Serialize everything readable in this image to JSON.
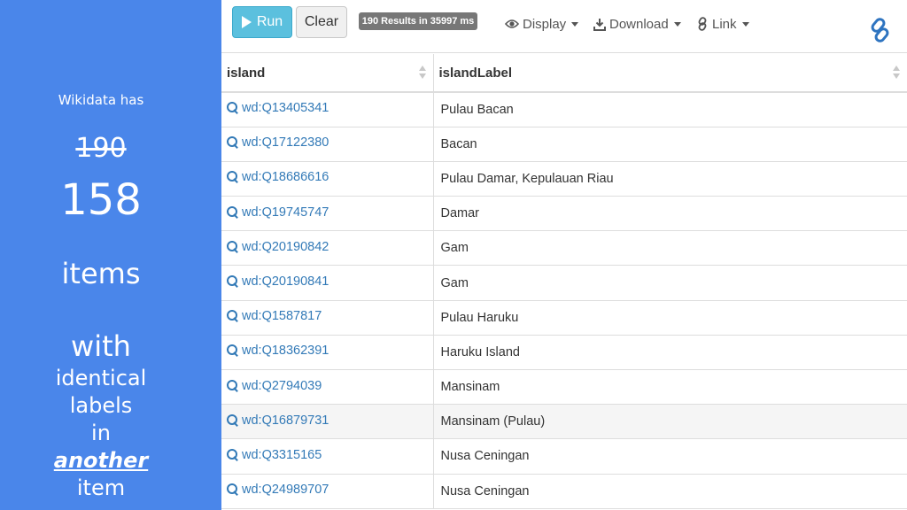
{
  "sidebar": {
    "intro": "Wikidata has",
    "old_count": "190",
    "new_count": "158",
    "items_word": "items",
    "with_word": "with",
    "identical_word": "identical",
    "labels_word": "labels",
    "in_word": "in",
    "another_word": "another",
    "item_word": "item"
  },
  "toolbar": {
    "run_label": "Run",
    "clear_label": "Clear",
    "results_text": "190 Results in 35997 ms",
    "display_label": "Display",
    "download_label": "Download",
    "link_label": "Link",
    "run_color": "#5bc0de"
  },
  "table": {
    "columns": [
      "island",
      "islandLabel"
    ],
    "rows": [
      {
        "id": "wd:Q13405341",
        "label": "Pulau Bacan"
      },
      {
        "id": "wd:Q17122380",
        "label": "Bacan"
      },
      {
        "id": "wd:Q18686616",
        "label": "Pulau Damar, Kepulauan Riau"
      },
      {
        "id": "wd:Q19745747",
        "label": "Damar"
      },
      {
        "id": "wd:Q20190842",
        "label": "Gam"
      },
      {
        "id": "wd:Q20190841",
        "label": "Gam"
      },
      {
        "id": "wd:Q1587817",
        "label": "Pulau Haruku"
      },
      {
        "id": "wd:Q18362391",
        "label": "Haruku Island"
      },
      {
        "id": "wd:Q2794039",
        "label": "Mansinam"
      },
      {
        "id": "wd:Q16879731",
        "label": "Mansinam (Pulau)"
      },
      {
        "id": "wd:Q3315165",
        "label": "Nusa Ceningan"
      },
      {
        "id": "wd:Q24989707",
        "label": "Nusa Ceningan"
      }
    ]
  }
}
